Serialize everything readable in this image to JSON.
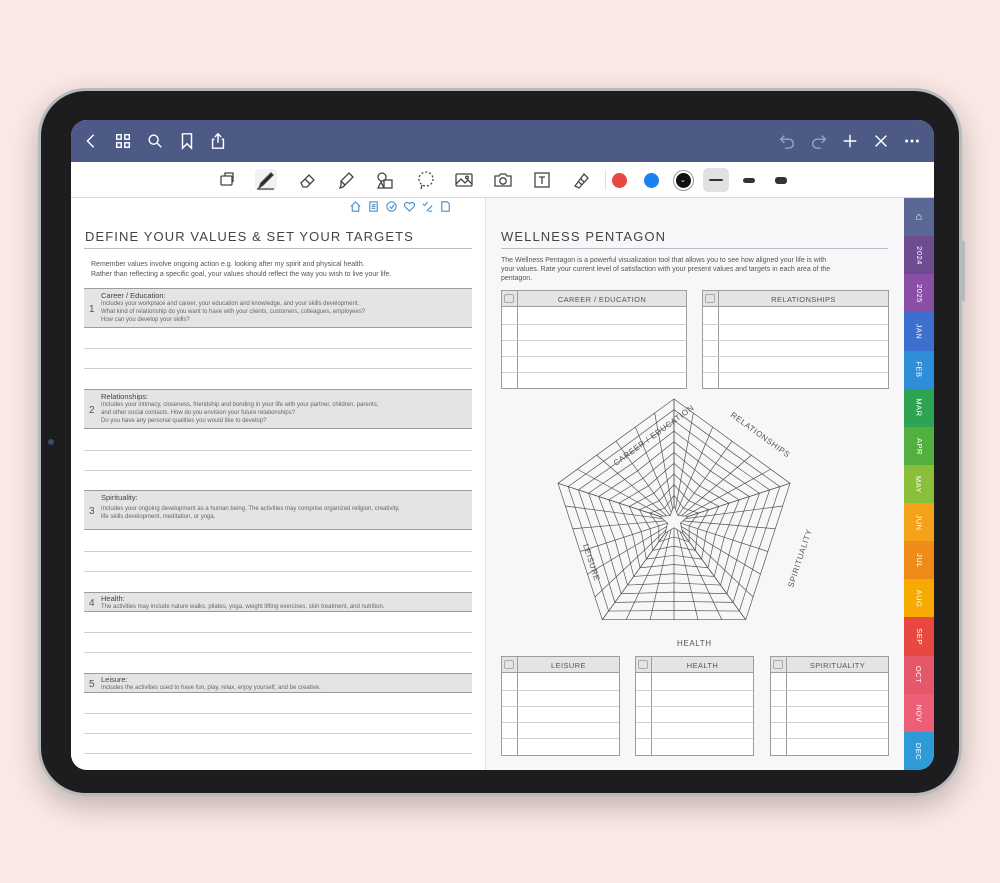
{
  "toolbar_top": {
    "back": "back-icon",
    "grid": "grid-icon",
    "search": "search-icon",
    "bookmark": "bookmark-icon",
    "share": "share-icon",
    "undo": "undo-icon",
    "redo": "redo-icon",
    "add": "plus-icon",
    "close": "close-icon",
    "more": "more-icon"
  },
  "pen_toolbar": {
    "colors": [
      "#e8483f",
      "#1a82f0",
      "#111111"
    ],
    "tools": [
      "lasso-select-icon",
      "pen-icon",
      "eraser-icon",
      "highlighter-icon",
      "shapes-icon",
      "lasso-icon",
      "image-icon",
      "camera-icon",
      "text-icon",
      "tape-icon"
    ]
  },
  "left": {
    "title": "DEFINE YOUR VALUES & SET YOUR TARGETS",
    "intro_line1": "Remember values involve ongoing action e.g. looking after my spirit and physical health.",
    "intro_line2": "Rather than reflecting a specific goal, your values should reflect the way you wish to live your life.",
    "sections": [
      {
        "num": "1",
        "title": "Career / Education:",
        "desc1": "Includes your workplace and career, your education and knowledge, and your skills development.",
        "desc2": "What kind of relationship do you want to have with your clients, customers, colleagues, employees?",
        "desc3": "How can you develop your skills?"
      },
      {
        "num": "2",
        "title": "Relationships:",
        "desc1": "Includes your intimacy, closeness, friendship and bonding in your life with your partner, children, parents,",
        "desc2": "and other social contacts. How do you envision your future relationships?",
        "desc3": "Do you have any personal qualities you would like to develop?"
      },
      {
        "num": "3",
        "title": "Spirituality:",
        "desc1": "Includes your ongoing development as a human being. The activities may comprise organized religion, creativity,",
        "desc2": "life skills development, meditation, or yoga.",
        "desc3": ""
      },
      {
        "num": "4",
        "title": "Health:",
        "desc1": "The activities may include nature walks, pilates, yoga, weight lifting exercises, skin treatment, and nutrition.",
        "desc2": "",
        "desc3": ""
      },
      {
        "num": "5",
        "title": "Leisure:",
        "desc1": "Includes the activities used to have fun, play, relax, enjoy yourself, and be creative.",
        "desc2": "",
        "desc3": ""
      }
    ]
  },
  "right": {
    "title": "WELLNESS PENTAGON",
    "intro1": "The Wellness Pentagon is a powerful visualization tool that allows you to see how aligned your life is with",
    "intro2": "your values. Rate your current level of satisfaction with your present values and targets in each area of the",
    "intro3": "pentagon.",
    "boxes": [
      "CAREER / EDUCATION",
      "RELATIONSHIPS",
      "LEISURE",
      "HEALTH",
      "SPIRITUALITY"
    ],
    "pentagon_labels": [
      "CAREER / EDUCATION",
      "RELATIONSHIPS",
      "SPIRITUALITY",
      "HEALTH",
      "LEISURE"
    ]
  },
  "tabs": [
    {
      "label": "",
      "color": "#5b6794"
    },
    {
      "label": "2024",
      "color": "#6d4d8f"
    },
    {
      "label": "2025",
      "color": "#8a4ea6"
    },
    {
      "label": "JAN",
      "color": "#3c6fd0"
    },
    {
      "label": "FEB",
      "color": "#2f8ed8"
    },
    {
      "label": "MAR",
      "color": "#2ea352"
    },
    {
      "label": "APR",
      "color": "#54b03e"
    },
    {
      "label": "MAY",
      "color": "#8abf3a"
    },
    {
      "label": "JUN",
      "color": "#f4a21a"
    },
    {
      "label": "JUL",
      "color": "#f08b1a"
    },
    {
      "label": "AUG",
      "color": "#f6a900"
    },
    {
      "label": "SEP",
      "color": "#e8483f"
    },
    {
      "label": "OCT",
      "color": "#e6576a"
    },
    {
      "label": "NOV",
      "color": "#ec5f77"
    },
    {
      "label": "DEC",
      "color": "#2e9ad8"
    }
  ]
}
